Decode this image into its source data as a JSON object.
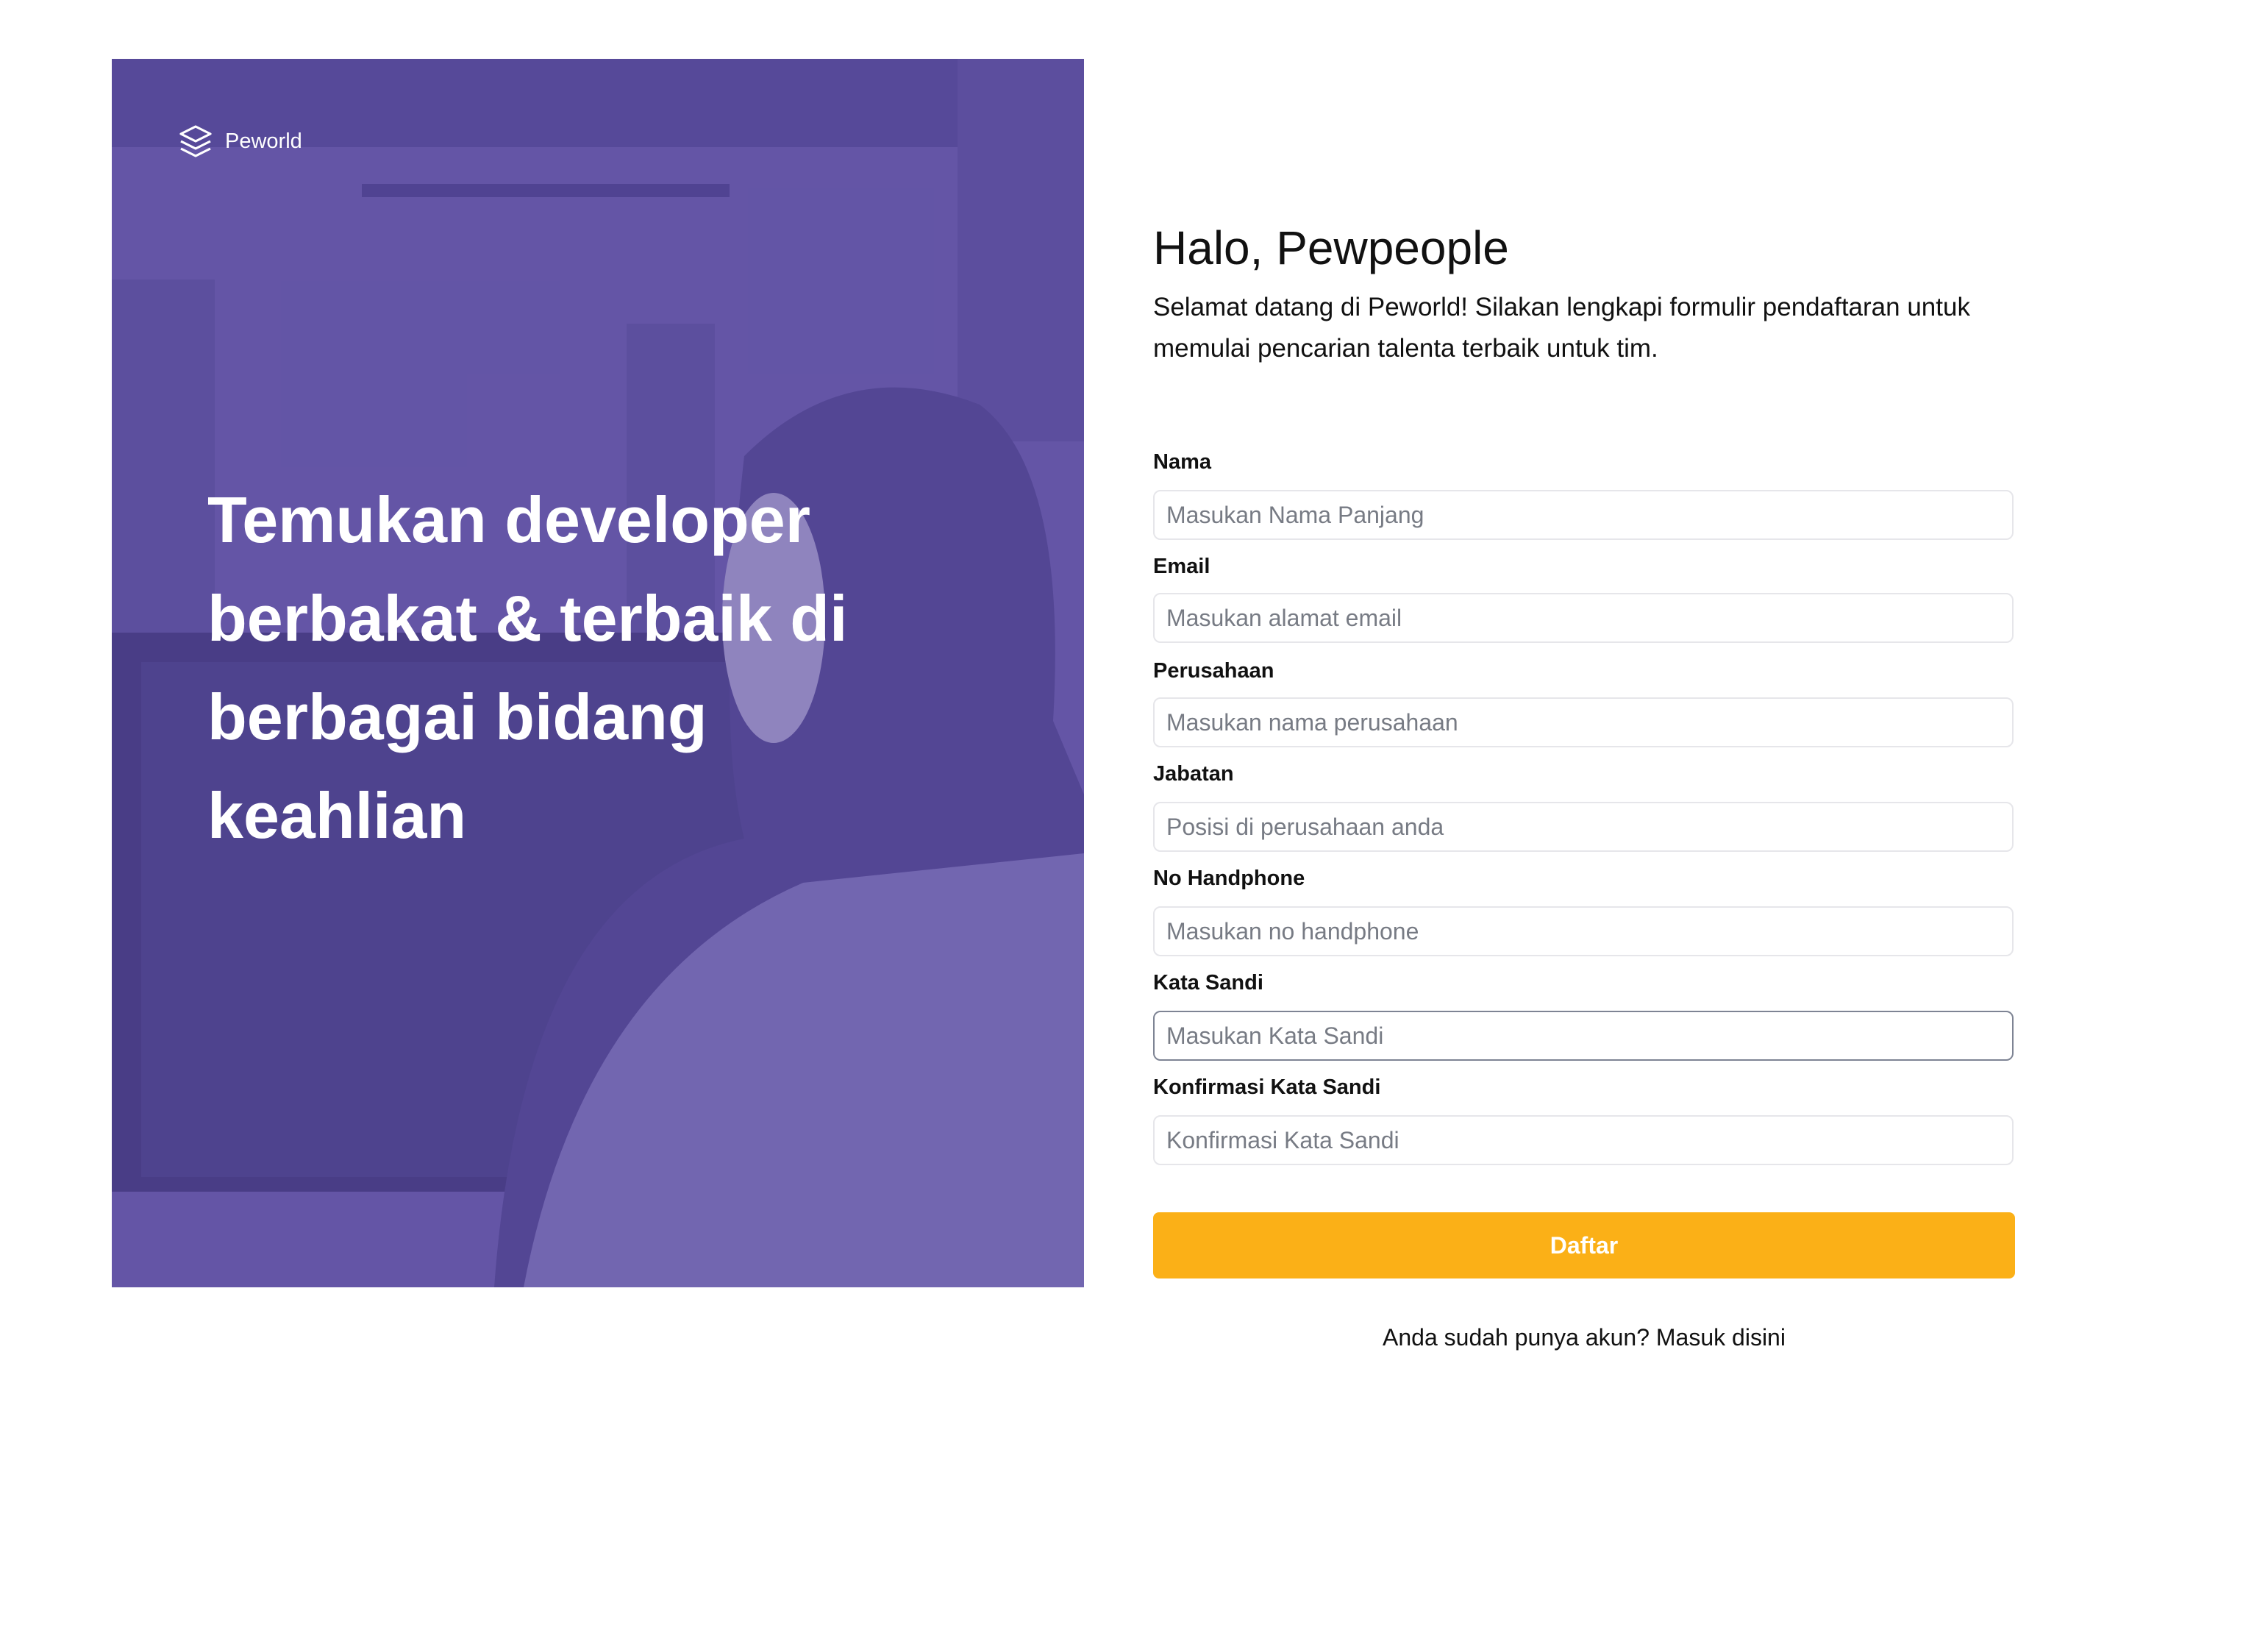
{
  "brand": {
    "name": "Peworld",
    "icon": "layers-logo-icon"
  },
  "hero": {
    "headline": "Temukan developer berbakat & terbaik di berbagai bidang keahlian"
  },
  "form": {
    "title": "Halo, Pewpeople",
    "subtitle": "Selamat datang di Peworld! Silakan lengkapi formulir pendaftaran untuk memulai pencarian talenta terbaik untuk tim.",
    "fields": [
      {
        "label": "Nama",
        "placeholder": "Masukan Nama Panjang",
        "value": ""
      },
      {
        "label": "Email",
        "placeholder": "Masukan alamat email",
        "value": ""
      },
      {
        "label": "Perusahaan",
        "placeholder": "Masukan nama perusahaan",
        "value": ""
      },
      {
        "label": "Jabatan",
        "placeholder": "Posisi di perusahaan anda",
        "value": ""
      },
      {
        "label": "No Handphone",
        "placeholder": "Masukan no handphone",
        "value": ""
      },
      {
        "label": "Kata Sandi",
        "placeholder": "Masukan Kata Sandi",
        "value": ""
      },
      {
        "label": "Konfirmasi Kata Sandi",
        "placeholder": "Konfirmasi Kata Sandi",
        "value": ""
      }
    ],
    "submit_label": "Daftar",
    "login_text": "Anda sudah punya akun? Masuk disini"
  },
  "colors": {
    "hero_tint": "#5e50a1",
    "accent": "#fbb017",
    "focus_border": "#7e8494"
  }
}
